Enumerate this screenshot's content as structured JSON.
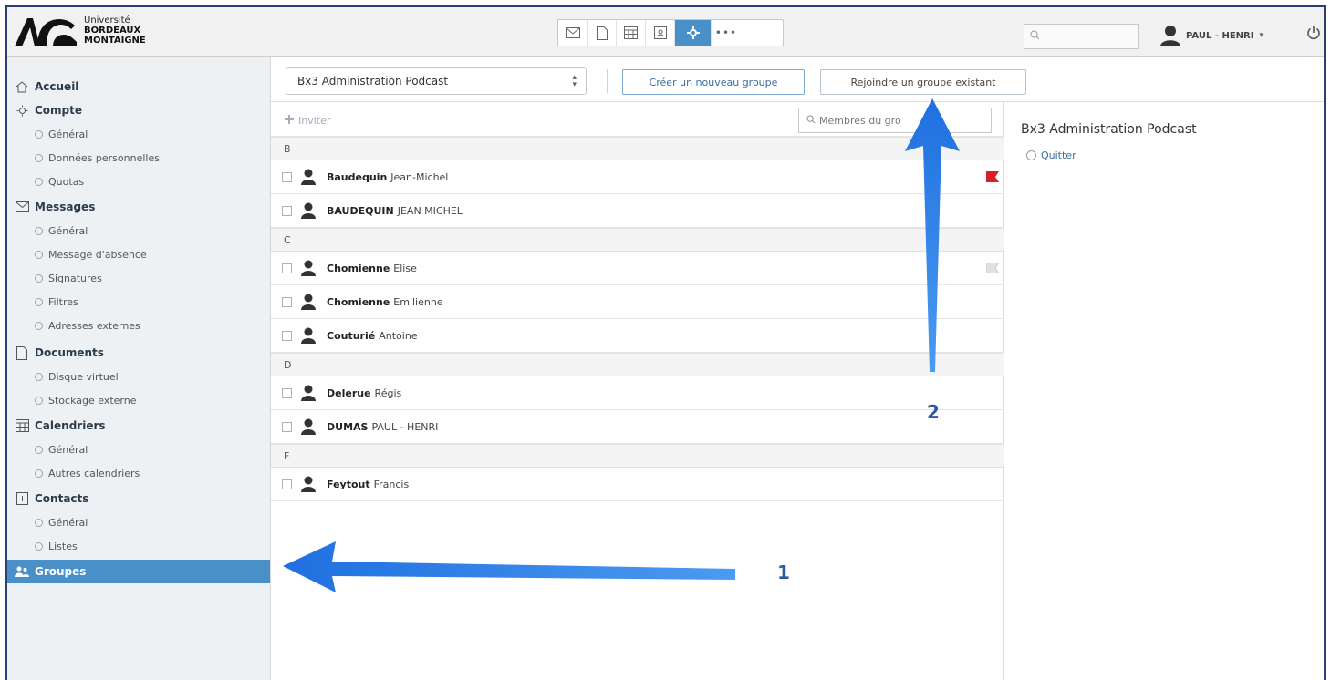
{
  "logo": {
    "line1": "Université",
    "line2": "BORDEAUX",
    "line3": "MONTAIGNE"
  },
  "topbar": {
    "apps": [
      "mail-icon",
      "document-icon",
      "calendar-icon",
      "contacts-icon",
      "settings-icon",
      "more-icon"
    ],
    "more_label": "•••",
    "search_placeholder": "",
    "user_name": "PAUL - HENRI",
    "caret": "▾"
  },
  "sidebar": {
    "accueil": "Accueil",
    "compte": "Compte",
    "compte_items": [
      "Général",
      "Données personnelles",
      "Quotas"
    ],
    "messages": "Messages",
    "messages_items": [
      "Général",
      "Message d'absence",
      "Signatures",
      "Filtres",
      "Adresses externes"
    ],
    "documents": "Documents",
    "documents_items": [
      "Disque virtuel",
      "Stockage externe"
    ],
    "calendriers": "Calendriers",
    "calendriers_items": [
      "Général",
      "Autres calendriers"
    ],
    "contacts": "Contacts",
    "contacts_items": [
      "Général",
      "Listes"
    ],
    "groupes": "Groupes"
  },
  "toolbar": {
    "group_selected": "Bx3 Administration Podcast",
    "create_label": "Créer un nouveau groupe",
    "join_label": "Rejoindre un groupe existant"
  },
  "list": {
    "invite_label": "Inviter",
    "search_placeholder": "Membres du gro",
    "sections": [
      {
        "letter": "B",
        "members": [
          {
            "last": "Baudequin",
            "first": "Jean-Michel",
            "flag": "red"
          },
          {
            "last": "BAUDEQUIN",
            "first": "JEAN MICHEL",
            "flag": ""
          }
        ]
      },
      {
        "letter": "C",
        "members": [
          {
            "last": "Chomienne",
            "first": "Elise",
            "flag": "grey"
          },
          {
            "last": "Chomienne",
            "first": "Emilienne",
            "flag": ""
          },
          {
            "last": "Couturié",
            "first": "Antoine",
            "flag": ""
          }
        ]
      },
      {
        "letter": "D",
        "members": [
          {
            "last": "Delerue",
            "first": "Régis",
            "flag": ""
          },
          {
            "last": "DUMAS",
            "first": "PAUL - HENRI",
            "flag": ""
          }
        ]
      },
      {
        "letter": "F",
        "members": [
          {
            "last": "Feytout",
            "first": "Francis",
            "flag": ""
          }
        ]
      }
    ]
  },
  "detail": {
    "title": "Bx3 Administration Podcast",
    "quit_label": "Quitter"
  },
  "annotations": {
    "label1": "1",
    "label2": "2",
    "color": "#2e7fe0"
  }
}
